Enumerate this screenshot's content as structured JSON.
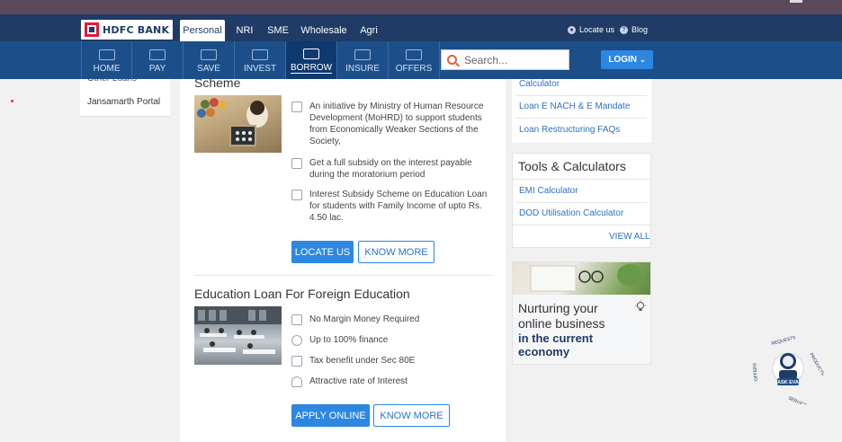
{
  "header": {
    "logo_text": "HDFC BANK",
    "top_tabs": [
      {
        "label": "Personal",
        "active": true
      },
      {
        "label": "NRI",
        "active": false
      },
      {
        "label": "SME",
        "active": false
      },
      {
        "label": "Wholesale",
        "active": false
      },
      {
        "label": "Agri",
        "active": false
      }
    ],
    "locate_us": "Locate us",
    "blog": "Blog"
  },
  "nav": {
    "items": [
      {
        "label": "HOME",
        "icon": "home-icon"
      },
      {
        "label": "PAY",
        "icon": "pay-icon"
      },
      {
        "label": "SAVE",
        "icon": "save-icon"
      },
      {
        "label": "INVEST",
        "icon": "invest-icon"
      },
      {
        "label": "BORROW",
        "icon": "borrow-icon",
        "active": true
      },
      {
        "label": "INSURE",
        "icon": "insure-icon"
      },
      {
        "label": "OFFERS",
        "icon": "offers-icon"
      }
    ],
    "search_placeholder": "Search...",
    "login_label": "LOGIN"
  },
  "sidebar": {
    "items": [
      "Other Loans",
      "Jansamarth Portal"
    ]
  },
  "main": {
    "section1": {
      "title_cut": "Scheme",
      "features": [
        "An initiative by Ministry of Human Resource Development (MoHRD) to support students from Economically Weaker Sections of the Society,",
        "Get a full subsidy on the interest payable during the moratorium period",
        "Interest Subsidy Scheme on Education Loan for students with Family Income of upto Rs. 4.50 lac."
      ],
      "btn_primary": "LOCATE US",
      "btn_secondary": "KNOW MORE"
    },
    "section2": {
      "title": "Education Loan For Foreign Education",
      "features": [
        "No Margin Money Required",
        "Up to 100% finance",
        "Tax benefit under Sec 80E",
        "Attractive rate of Interest"
      ],
      "btn_primary": "APPLY ONLINE",
      "btn_secondary": "KNOW MORE"
    }
  },
  "right": {
    "links": [
      "Calculator",
      "Loan E NACH & E Mandate",
      "Loan Restructuring FAQs"
    ],
    "tools": {
      "title": "Tools & Calculators",
      "items": [
        "EMI Calculator",
        "DOD Utilisation Calculator"
      ],
      "view_all": "VIEW ALL"
    },
    "promo": {
      "line1": "Nurturing your",
      "line2": "online business",
      "line3": "in the current",
      "line4": "economy"
    }
  },
  "eva": {
    "label": "ASK EVA",
    "ring": [
      "REQUESTS",
      "PRODUCTS",
      "SERVICES",
      "OFFERS"
    ]
  },
  "colors": {
    "header_bg": "#1f3b66",
    "nav_bg": "#1c4f8a",
    "accent_blue": "#2d87e0",
    "logo_red": "#e31837"
  }
}
